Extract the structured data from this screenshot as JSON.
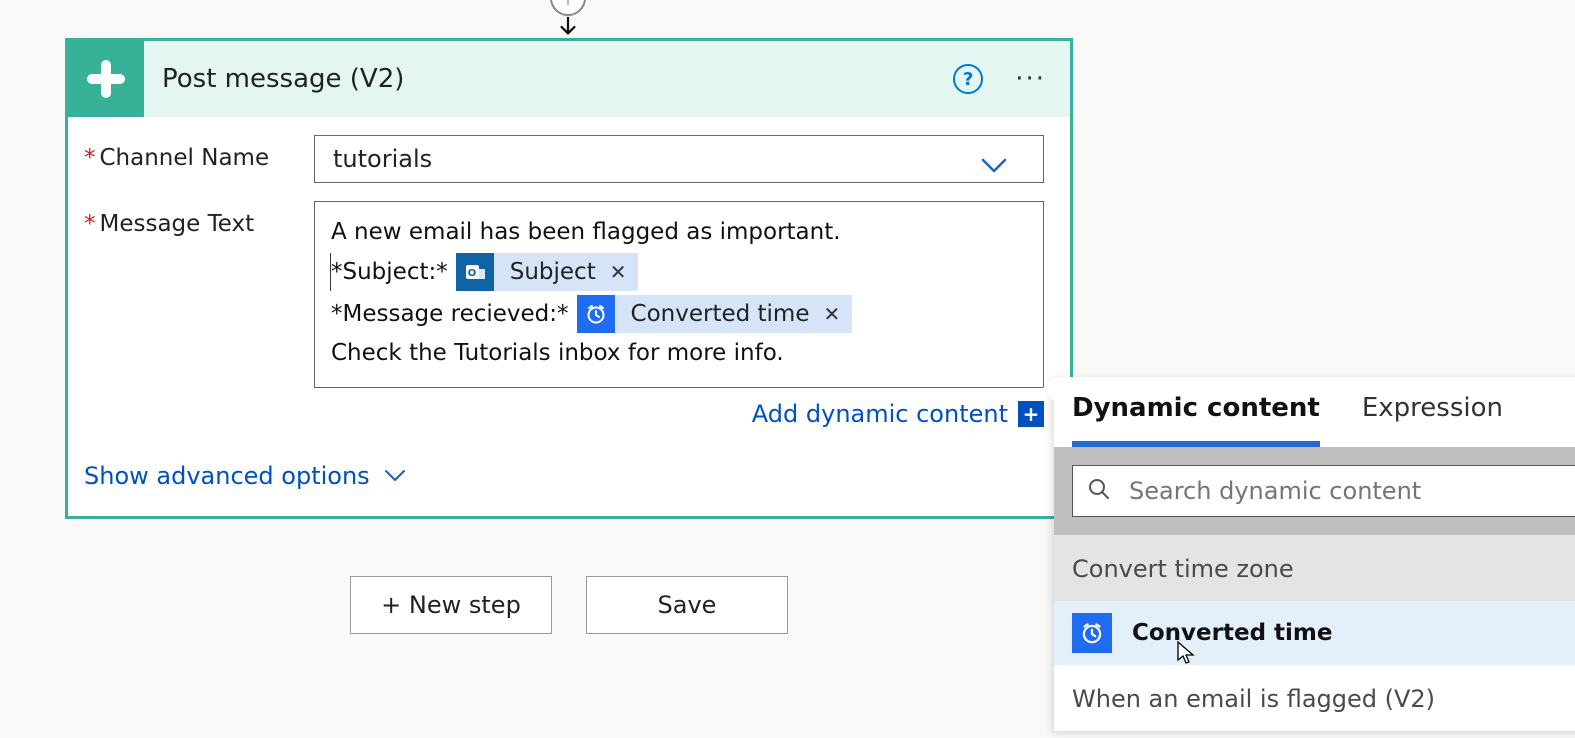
{
  "card": {
    "title": "Post message (V2)",
    "accentColor": "#38b199"
  },
  "fields": {
    "channelName": {
      "label": "Channel Name",
      "value": "tutorials"
    },
    "messageText": {
      "label": "Message Text",
      "line1": "A new email has been flagged as important.",
      "line2_prefix": "*Subject:*",
      "line3_prefix": "*Message recieved:*",
      "line4": "Check the Tutorials inbox for more info."
    }
  },
  "tokens": {
    "subject": {
      "label": "Subject",
      "iconColor": "#1064a6"
    },
    "convertedTime": {
      "label": "Converted time",
      "iconColor": "#1f6cf0"
    }
  },
  "links": {
    "addDynamicContent": "Add dynamic content",
    "showAdvanced": "Show advanced options"
  },
  "buttons": {
    "newStep": "+ New step",
    "save": "Save"
  },
  "dynamicContentPanel": {
    "tabs": {
      "dynamic": "Dynamic content",
      "expression": "Expression"
    },
    "searchPlaceholder": "Search dynamic content",
    "sections": [
      {
        "title": "Convert time zone",
        "items": [
          {
            "label": "Converted time",
            "icon": "clock"
          }
        ]
      },
      {
        "title": "When an email is flagged (V2)",
        "items": []
      }
    ]
  }
}
